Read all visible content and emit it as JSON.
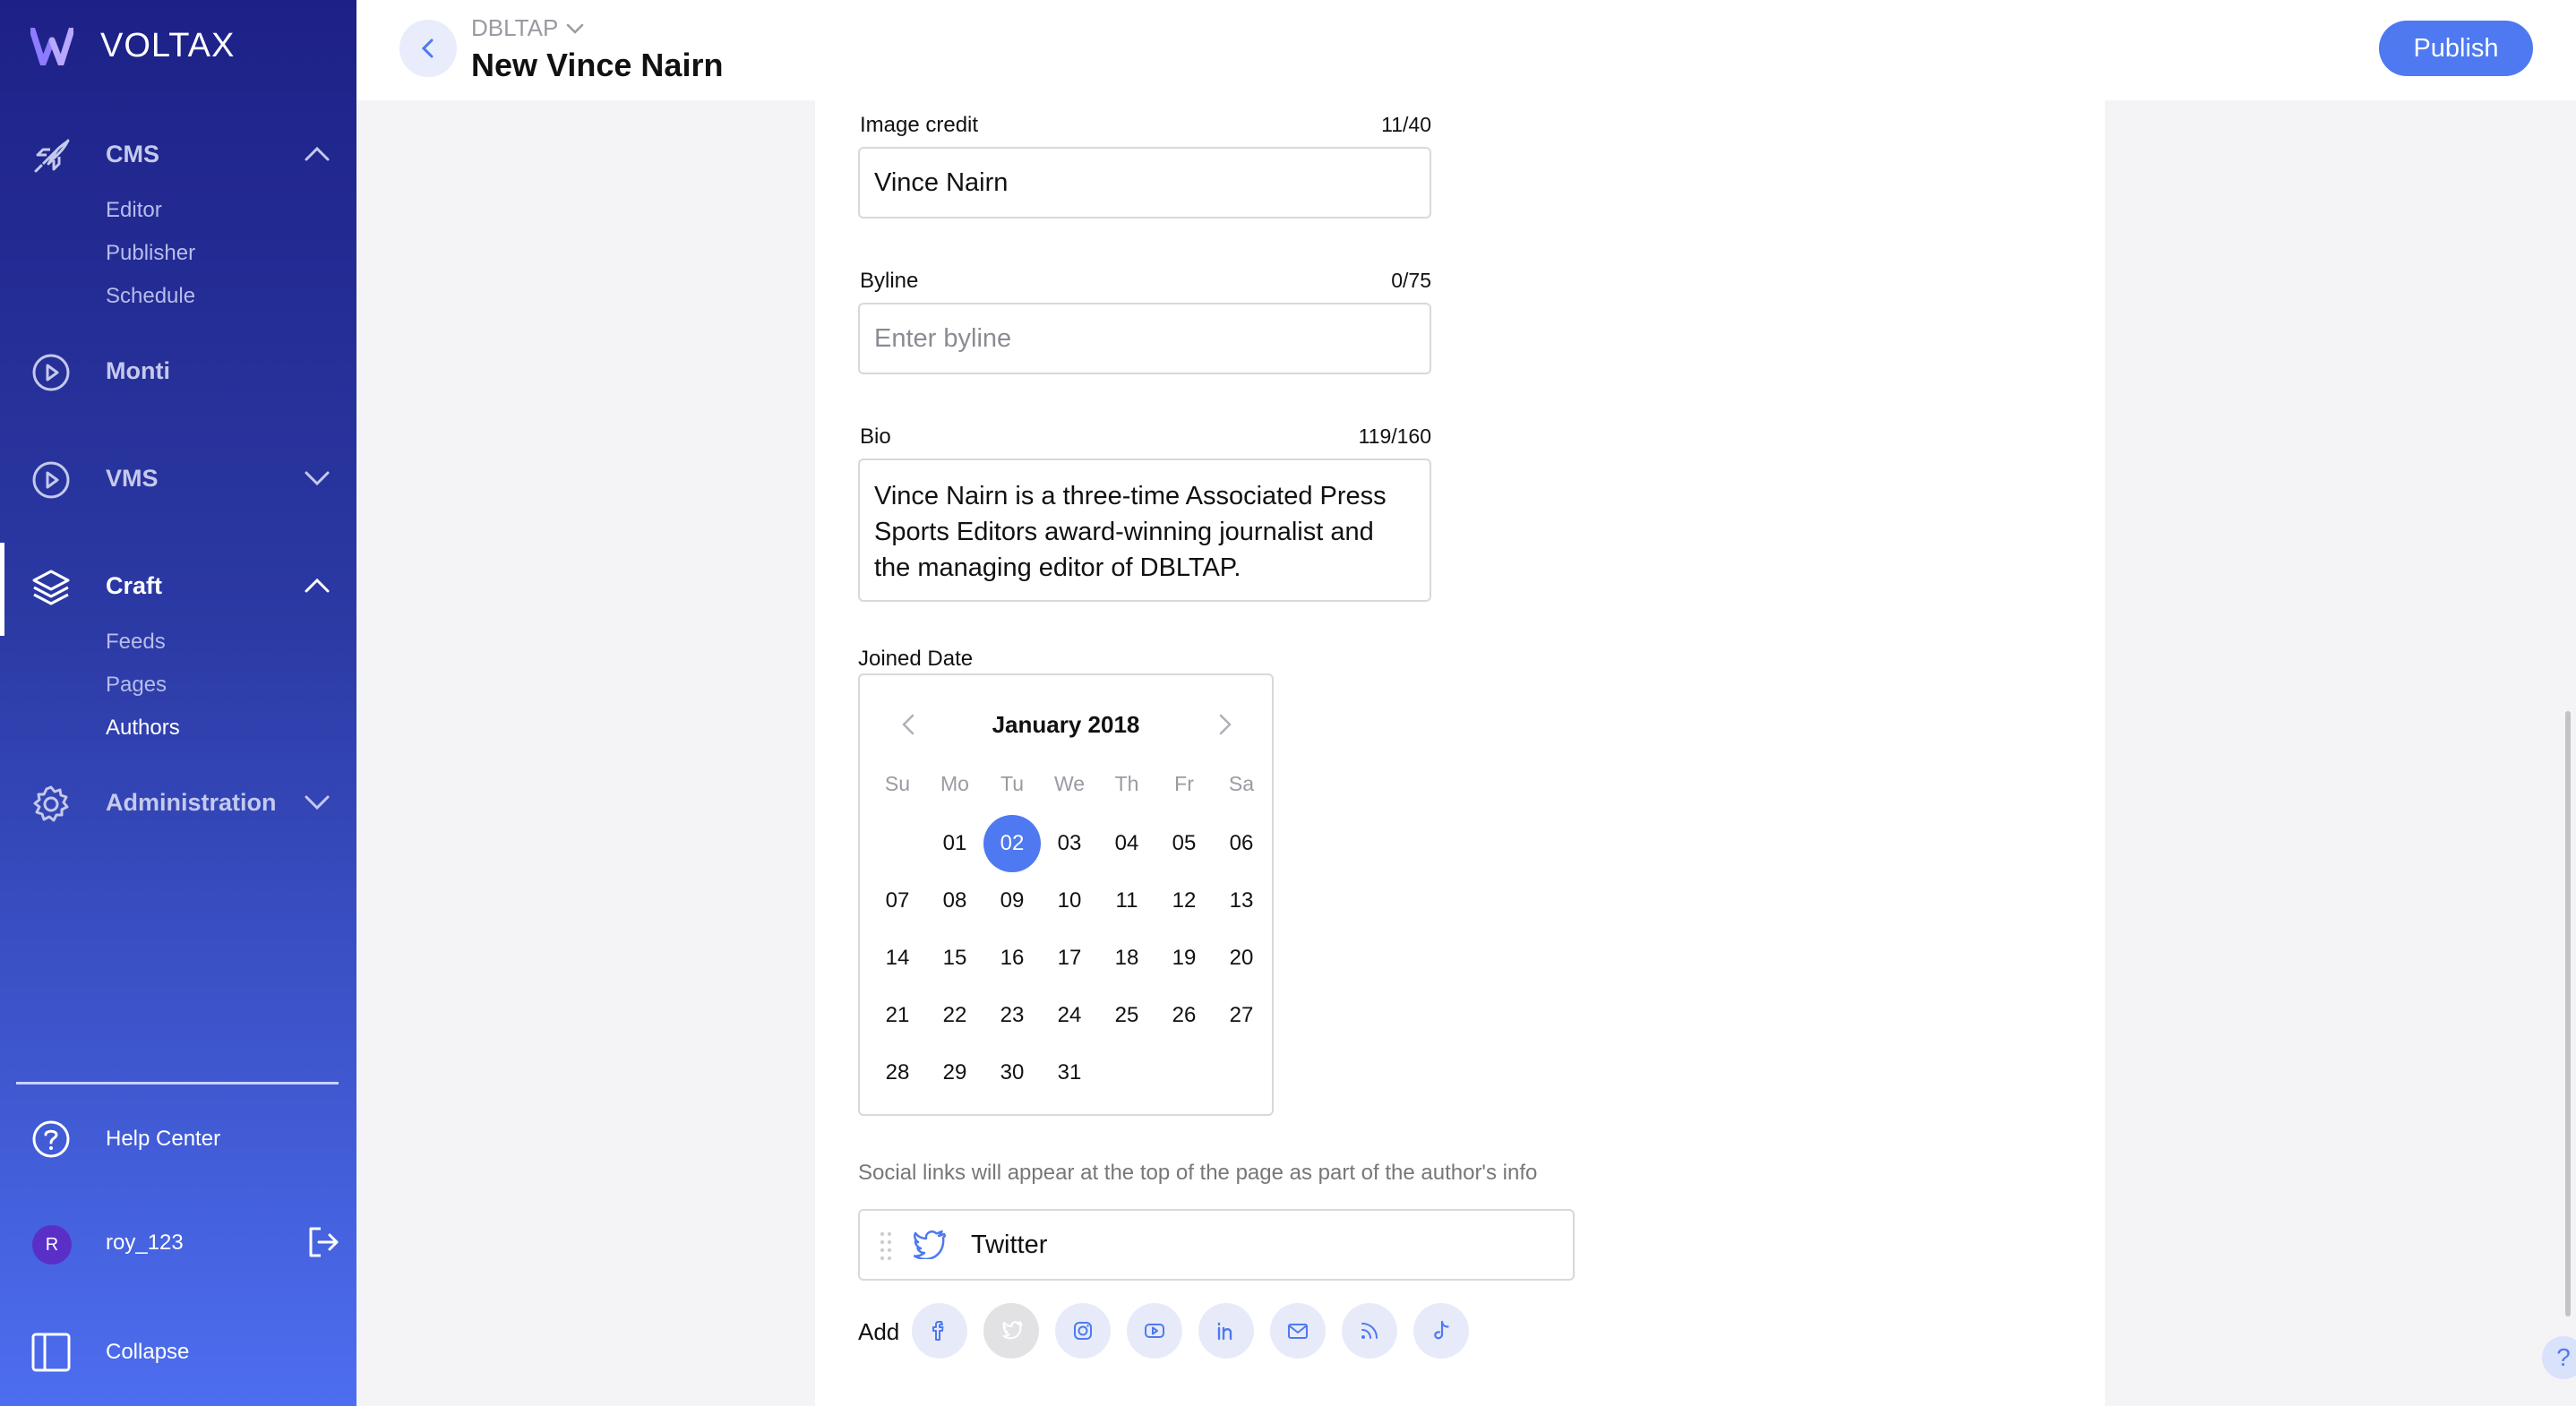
{
  "brand": {
    "name": "VOLTAX"
  },
  "sidebar": {
    "sections": [
      {
        "label": "CMS",
        "icon": "rocket-icon",
        "items": [
          "Editor",
          "Publisher",
          "Schedule"
        ]
      },
      {
        "label": "Monti",
        "icon": "play-circle-icon"
      },
      {
        "label": "VMS",
        "icon": "play-circle-icon"
      },
      {
        "label": "Craft",
        "icon": "layers-icon",
        "items": [
          "Feeds",
          "Pages",
          "Authors"
        ],
        "current_item": "Authors"
      },
      {
        "label": "Administration",
        "icon": "gear-icon"
      }
    ],
    "help_center": "Help Center",
    "user": {
      "initial": "R",
      "name": "roy_123"
    },
    "collapse": "Collapse"
  },
  "header": {
    "site": "DBLTAP",
    "title": "New Vince Nairn",
    "publish_label": "Publish"
  },
  "form": {
    "image_credit": {
      "label": "Image credit",
      "counter": "11/40",
      "value": "Vince Nairn"
    },
    "byline": {
      "label": "Byline",
      "counter": "0/75",
      "placeholder": "Enter byline"
    },
    "bio": {
      "label": "Bio",
      "counter": "119/160",
      "value": "Vince Nairn is a three-time Associated Press Sports Editors award-winning journalist and the managing editor of DBLTAP."
    },
    "joined_date": {
      "label": "Joined Date",
      "calendar": {
        "month_label": "January 2018",
        "weekdays": [
          "Su",
          "Mo",
          "Tu",
          "We",
          "Th",
          "Fr",
          "Sa"
        ],
        "first_weekday_index": 1,
        "days": [
          "01",
          "02",
          "03",
          "04",
          "05",
          "06",
          "07",
          "08",
          "09",
          "10",
          "11",
          "12",
          "13",
          "14",
          "15",
          "16",
          "17",
          "18",
          "19",
          "20",
          "21",
          "22",
          "23",
          "24",
          "25",
          "26",
          "27",
          "28",
          "29",
          "30",
          "31"
        ],
        "selected": "02"
      }
    },
    "social": {
      "hint": "Social links will appear at the top of the page as part of the author's info",
      "links": [
        {
          "network": "Twitter",
          "icon": "twitter-icon"
        }
      ],
      "add_label": "Add",
      "add_buttons": [
        {
          "network": "facebook",
          "icon": "facebook-icon",
          "enabled": true
        },
        {
          "network": "twitter",
          "icon": "twitter-icon",
          "enabled": false
        },
        {
          "network": "instagram",
          "icon": "instagram-icon",
          "enabled": true
        },
        {
          "network": "youtube",
          "icon": "youtube-icon",
          "enabled": true
        },
        {
          "network": "linkedin",
          "icon": "linkedin-icon",
          "enabled": true
        },
        {
          "network": "email",
          "icon": "mail-icon",
          "enabled": true
        },
        {
          "network": "rss",
          "icon": "rss-icon",
          "enabled": true
        },
        {
          "network": "tiktok",
          "icon": "tiktok-icon",
          "enabled": true
        }
      ]
    }
  },
  "colors": {
    "accent": "#4e79f0",
    "sidebar_top": "#1d2187",
    "sidebar_bottom": "#4d6ef0"
  }
}
